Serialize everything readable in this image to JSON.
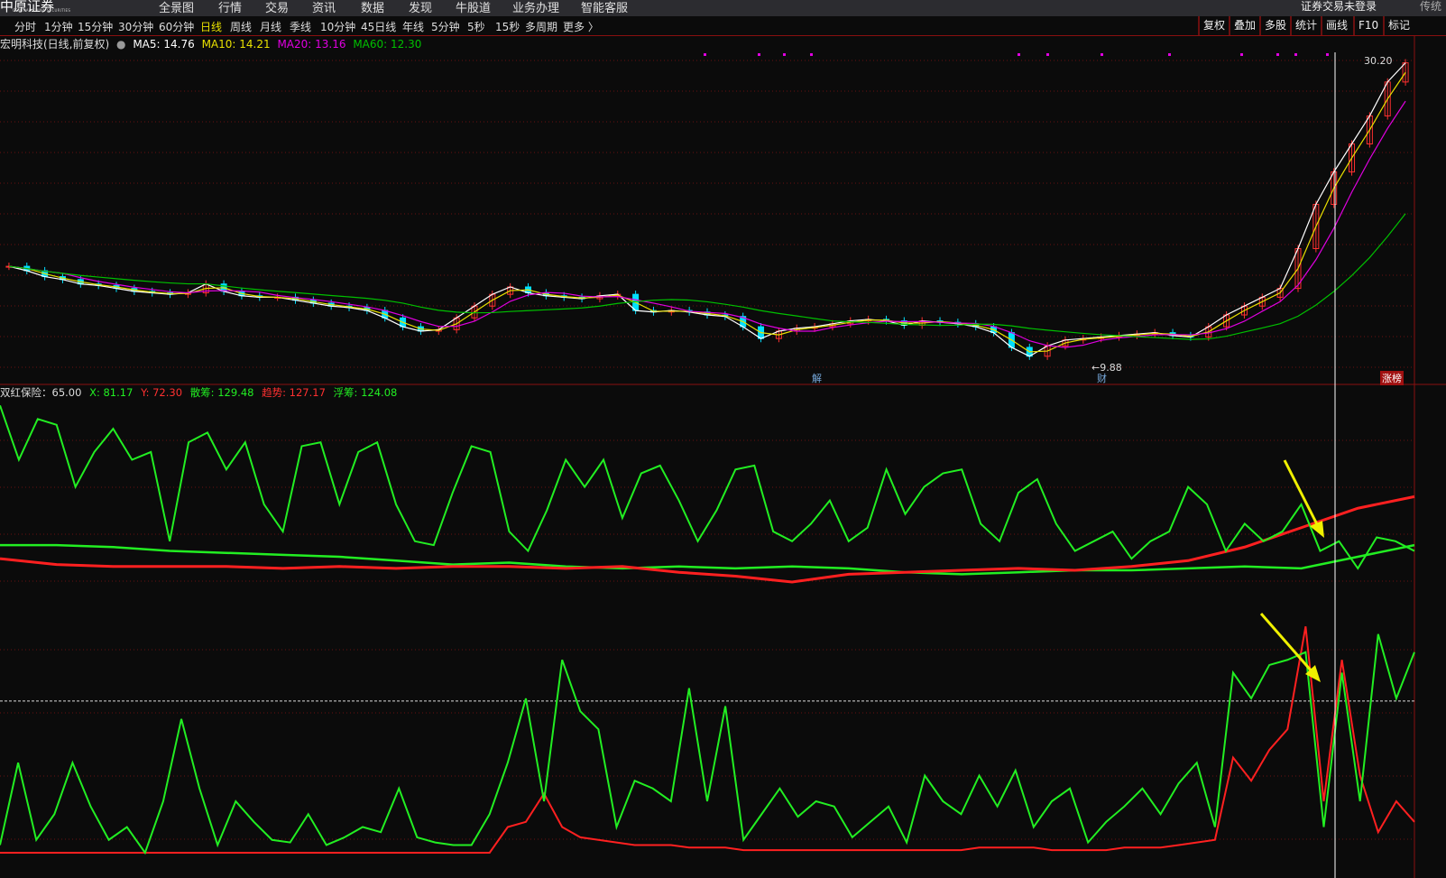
{
  "topbar": {
    "logo_text": "中原证券",
    "logo_sub": "CENTRAL CHINA SECURITIES",
    "nav": [
      "全景图",
      "行情",
      "交易",
      "资讯",
      "数据",
      "发现",
      "牛股道",
      "业务办理",
      "智能客服"
    ],
    "login_status": "证券交易未登录",
    "mode": "传统"
  },
  "periods": {
    "items": [
      "分时",
      "1分钟",
      "15分钟",
      "30分钟",
      "60分钟",
      "日线",
      "周线",
      "月线",
      "季线",
      "10分钟",
      "45日线",
      "年线",
      "5分钟",
      "5秒",
      "15秒",
      "多周期",
      "更多 〉"
    ],
    "active": "日线"
  },
  "tools": [
    "复权",
    "叠加",
    "多股",
    "统计",
    "画线",
    "F10",
    "标记"
  ],
  "info": {
    "stock": "宏明科技(日线,前复权)",
    "ma5": "MA5: 14.76",
    "ma10": "MA10: 14.21",
    "ma20": "MA20: 13.16",
    "ma60": "MA60: 12.30"
  },
  "colors": {
    "ma5": "#ffffff",
    "ma10": "#e8e000",
    "ma20": "#e000e0",
    "ma60": "#00c000",
    "up": "#ff3030",
    "down": "#00e0ff",
    "accent_red": "#ff2020",
    "accent_green": "#22ee22"
  },
  "price_labels": {
    "high": "30.20",
    "low": "←9.88",
    "mark_jie": "解",
    "mark_cai": "财",
    "mark_zhang": "涨榜"
  },
  "indicator": {
    "name": "双红保险：65.00",
    "x": "X: 81.17",
    "y": "Y: 72.30",
    "sanchou": "散筹: 129.48",
    "qushi": "趋势: 127.17",
    "fuchou": "浮筹: 124.08"
  },
  "chart_data": {
    "type": "candlestick",
    "price_range": [
      9.88,
      30.2
    ],
    "closes": [
      16.3,
      16.0,
      15.6,
      15.4,
      15.1,
      15.0,
      14.8,
      14.6,
      14.5,
      14.4,
      14.5,
      15.1,
      14.6,
      14.3,
      14.2,
      14.2,
      14.0,
      13.8,
      13.6,
      13.5,
      13.3,
      12.8,
      12.2,
      11.9,
      12.0,
      12.8,
      13.6,
      14.4,
      14.9,
      14.5,
      14.3,
      14.2,
      14.1,
      14.3,
      14.4,
      13.3,
      13.2,
      13.3,
      13.2,
      13.0,
      12.9,
      12.2,
      11.4,
      11.9,
      12.1,
      12.2,
      12.4,
      12.6,
      12.7,
      12.6,
      12.3,
      12.6,
      12.5,
      12.4,
      12.2,
      11.8,
      10.8,
      10.2,
      10.9,
      11.3,
      11.4,
      11.5,
      11.6,
      11.7,
      11.8,
      11.6,
      11.5,
      12.2,
      13.0,
      13.6,
      14.2,
      14.8,
      17.5,
      20.5,
      22.7,
      24.6,
      26.5,
      28.8,
      30.1
    ],
    "panel1": {
      "osc": [
        98,
        70,
        91,
        88,
        56,
        74,
        86,
        70,
        74,
        28,
        79,
        84,
        65,
        79,
        47,
        33,
        77,
        79,
        47,
        74,
        79,
        47,
        28,
        26,
        53,
        77,
        74,
        33,
        23,
        44,
        70,
        56,
        70,
        40,
        63,
        67,
        49,
        28,
        44,
        65,
        67,
        33,
        28,
        37,
        49,
        28,
        35,
        65,
        42,
        56,
        63,
        65,
        37,
        28,
        53,
        60,
        37,
        23,
        28,
        33,
        19,
        28,
        33,
        56,
        47,
        23,
        37,
        28,
        33,
        47,
        23,
        28,
        14,
        30,
        28,
        23
      ],
      "red": [
        19,
        16,
        15,
        15,
        15,
        14,
        15,
        14,
        15,
        15,
        14,
        15,
        12,
        10,
        7,
        11,
        12,
        13,
        14,
        13,
        15,
        18,
        25,
        35,
        45,
        51
      ],
      "green": [
        26,
        26,
        25,
        23,
        22,
        21,
        20,
        18,
        16,
        17,
        15,
        14,
        15,
        14,
        15,
        14,
        12,
        11,
        12,
        13,
        13,
        14,
        15,
        14,
        20,
        26
      ]
    },
    "panel2": {
      "ref_level": 59,
      "green": [
        3,
        35,
        5,
        15,
        35,
        18,
        5,
        10,
        0,
        20,
        52,
        25,
        3,
        20,
        12,
        5,
        4,
        15,
        3,
        6,
        10,
        8,
        25,
        6,
        4,
        3,
        3,
        15,
        35,
        60,
        20,
        75,
        55,
        48,
        10,
        28,
        25,
        20,
        64,
        20,
        57,
        5,
        15,
        25,
        14,
        20,
        18,
        6,
        12,
        18,
        4,
        30,
        20,
        15,
        30,
        18,
        32,
        10,
        20,
        25,
        4,
        12,
        18,
        25,
        15,
        27,
        35,
        10,
        70,
        60,
        73,
        75,
        78,
        10,
        70,
        20,
        85,
        60,
        78
      ],
      "red": [
        0,
        0,
        0,
        0,
        0,
        0,
        0,
        0,
        0,
        0,
        0,
        0,
        0,
        0,
        0,
        0,
        0,
        0,
        0,
        0,
        0,
        0,
        0,
        0,
        0,
        0,
        0,
        0,
        10,
        12,
        23,
        10,
        6,
        5,
        4,
        3,
        3,
        3,
        2,
        2,
        2,
        1,
        1,
        1,
        1,
        1,
        1,
        1,
        1,
        1,
        1,
        1,
        1,
        1,
        2,
        2,
        2,
        2,
        1,
        1,
        1,
        1,
        2,
        2,
        2,
        3,
        4,
        5,
        37,
        28,
        40,
        48,
        88,
        20,
        75,
        30,
        8,
        20,
        12
      ]
    }
  }
}
